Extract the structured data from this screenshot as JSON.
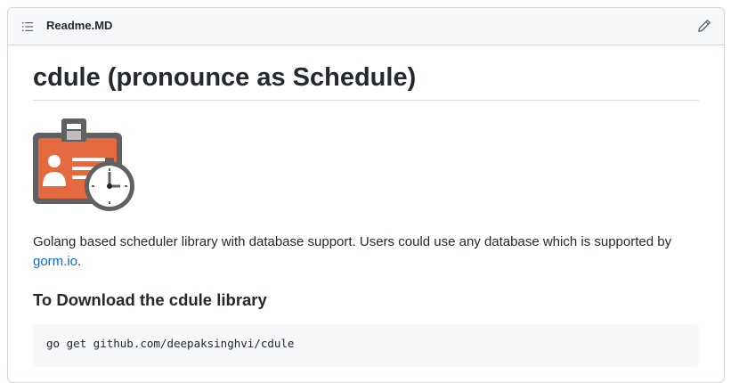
{
  "header": {
    "file_name": "Readme.MD",
    "toc_icon": "list-unordered-icon",
    "edit_icon": "pencil-icon"
  },
  "readme": {
    "title": "cdule (pronounce as Schedule)",
    "logo_icon": "id-badge-with-clock-icon",
    "description_text": "Golang based scheduler library with database support. Users could use any database which is supported by",
    "description_link": "gorm.io",
    "description_suffix": ".",
    "download_heading": "To Download the cdule library",
    "download_command": "go get github.com/deepaksinghvi/cdule"
  },
  "colors": {
    "link": "#0969da",
    "badge_orange": "#e5693e",
    "badge_gray": "#616161"
  }
}
